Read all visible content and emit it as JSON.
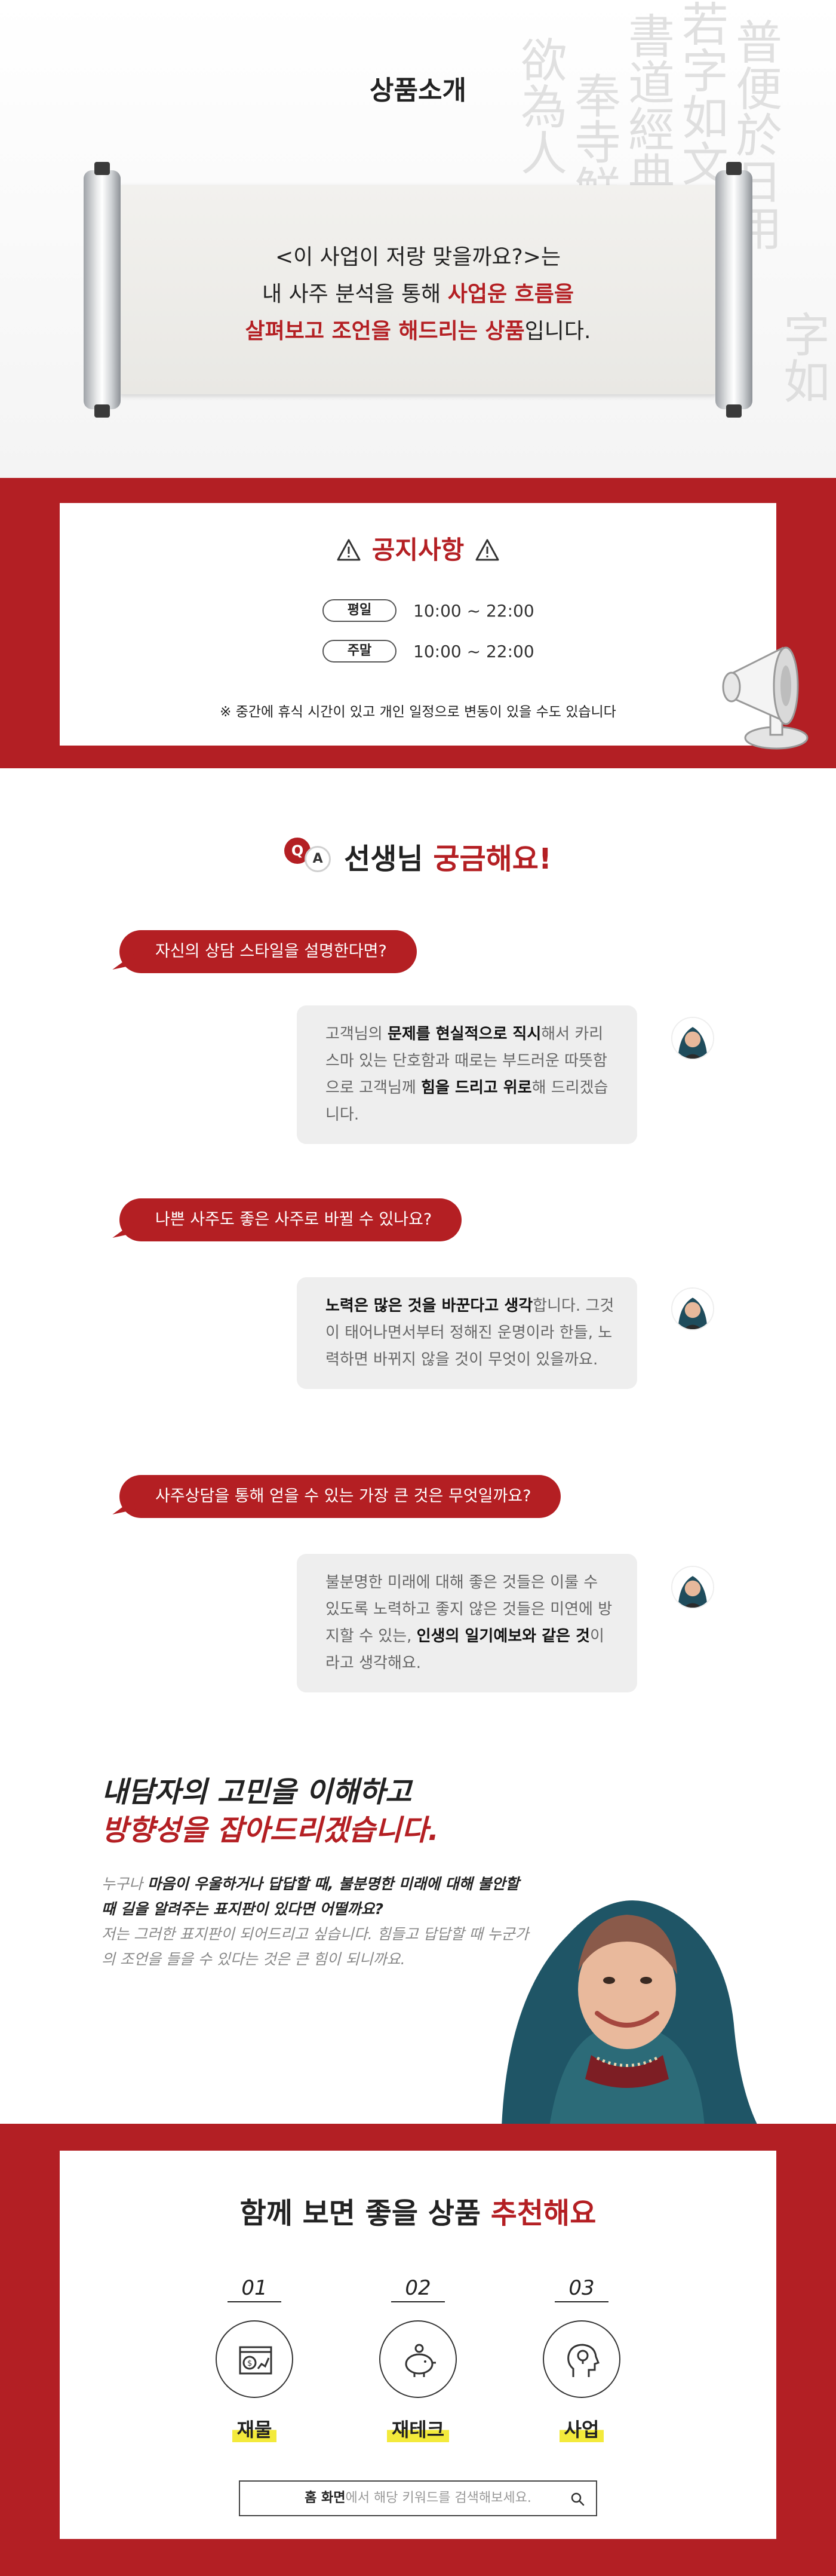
{
  "intro": {
    "title": "상품소개",
    "line1": "<이 사업이 저랑 맞을까요?>는",
    "line2_a": "내 사주 분석을 통해 ",
    "line2_b": "사업운 흐름을",
    "line3_a": "살펴보고 조언을 해드리는 상품",
    "line3_b": "입니다."
  },
  "notice": {
    "title": "공지사항",
    "rows": [
      {
        "day": "평일",
        "time": "10:00 ~ 22:00"
      },
      {
        "day": "주말",
        "time": "10:00 ~ 22:00"
      }
    ],
    "note": "※ 중간에 휴식 시간이 있고 개인 일정으로 변동이 있을 수도 있습니다"
  },
  "qa": {
    "badge_q": "Q",
    "badge_a": "A",
    "title_a": "선생님 ",
    "title_b": "궁금해요!",
    "items": [
      {
        "question": "자신의 상담 스타일을 설명한다면?",
        "answer": [
          {
            "t": "고객님의 ",
            "b": false
          },
          {
            "t": "문제를 현실적으로 직시",
            "b": true
          },
          {
            "t": "해서 카리스마 있는 단호함과 때로는 부드러운 따뜻함으로 고객님께 ",
            "b": false
          },
          {
            "t": "힘을 드리고 위로",
            "b": true
          },
          {
            "t": "해 드리겠습니다.",
            "b": false
          }
        ]
      },
      {
        "question": "나쁜 사주도 좋은 사주로 바뀔 수 있나요?",
        "answer": [
          {
            "t": "노력은 많은 것을 바꾼다고 생각",
            "b": true
          },
          {
            "t": "합니다. 그것이 태어나면서부터 정해진 운명이라 한들, 노력하면 바뀌지 않을 것이 무엇이 있을까요.",
            "b": false
          }
        ]
      },
      {
        "question": "사주상담을 통해 얻을 수 있는 가장 큰 것은 무엇일까요?",
        "answer": [
          {
            "t": "불분명한 미래에 대해 좋은 것들은 이룰 수 있도록 노력하고 좋지 않은 것들은 미연에 방지할 수 있는, ",
            "b": false
          },
          {
            "t": "인생의 일기예보와 같은 것",
            "b": true
          },
          {
            "t": "이라고 생각해요.",
            "b": false
          }
        ]
      }
    ]
  },
  "counselor": {
    "heading1": "내담자의 고민을 이해하고",
    "heading2": "방향성을 잡아드리겠습니다.",
    "p_a": "누구나 ",
    "p_b": "마음이 우울하거나 답답할 때, 불분명한 미래에 대해 불안할 때 길을 알려주는 표지판이 있다면 어떨까요?",
    "p_c": "저는 그러한 표지판이 되어드리고 싶습니다. 힘들고 답답할 때 누군가의 조언을 들을 수 있다는 것은 큰 힘이 되니까요."
  },
  "products": {
    "title_a": "함께 보면 좋을 상품 ",
    "title_b": "추천해요",
    "items": [
      {
        "num": "01",
        "label": "재물",
        "icon": "money-chart-icon"
      },
      {
        "num": "02",
        "label": "재테크",
        "icon": "piggy-bank-icon"
      },
      {
        "num": "03",
        "label": "사업",
        "icon": "idea-head-icon"
      }
    ],
    "search_a": "홈 화면",
    "search_b": "에서 해당 키워드를 검색해보세요."
  },
  "colors": {
    "accent": "#b31f24",
    "highlight": "#f3ea3b",
    "bubble_gray": "#eeeeee"
  }
}
